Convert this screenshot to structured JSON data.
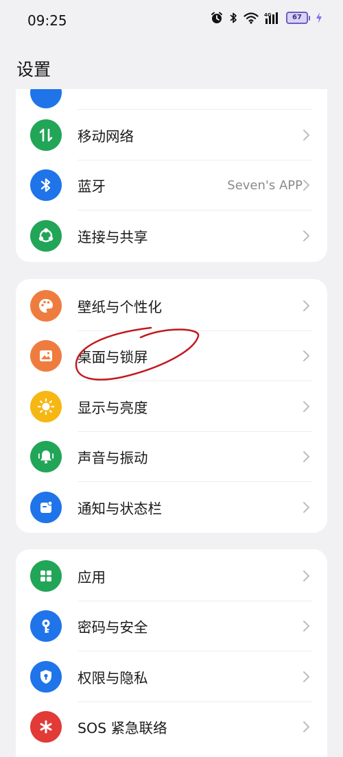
{
  "status_bar": {
    "time": "09:25",
    "battery_level": "67",
    "network": "4G"
  },
  "page": {
    "title": "设置"
  },
  "group1": {
    "items": [
      {
        "label": "移动网络",
        "value": "",
        "icon": "mobile-network-icon",
        "color": "#21a557"
      },
      {
        "label": "蓝牙",
        "value": "Seven's APP",
        "icon": "bluetooth-icon",
        "color": "#1f74ea"
      },
      {
        "label": "连接与共享",
        "value": "",
        "icon": "share-connect-icon",
        "color": "#21a557"
      }
    ]
  },
  "group2": {
    "items": [
      {
        "label": "壁纸与个性化",
        "icon": "palette-icon",
        "color": "#ef7c3f"
      },
      {
        "label": "桌面与锁屏",
        "icon": "picture-icon",
        "color": "#ef7c3f"
      },
      {
        "label": "显示与亮度",
        "icon": "brightness-icon",
        "color": "#f6b713"
      },
      {
        "label": "声音与振动",
        "icon": "bell-icon",
        "color": "#21a557"
      },
      {
        "label": "通知与状态栏",
        "icon": "notification-icon",
        "color": "#1f74ea"
      }
    ]
  },
  "group3": {
    "items": [
      {
        "label": "应用",
        "icon": "apps-grid-icon",
        "color": "#21a557"
      },
      {
        "label": "密码与安全",
        "icon": "key-icon",
        "color": "#1f74ea"
      },
      {
        "label": "权限与隐私",
        "icon": "shield-lock-icon",
        "color": "#1f74ea"
      },
      {
        "label": "SOS 紧急联络",
        "icon": "sos-asterisk-icon",
        "color": "#e23a36"
      }
    ]
  },
  "annotation": {
    "color": "#c2191f"
  }
}
